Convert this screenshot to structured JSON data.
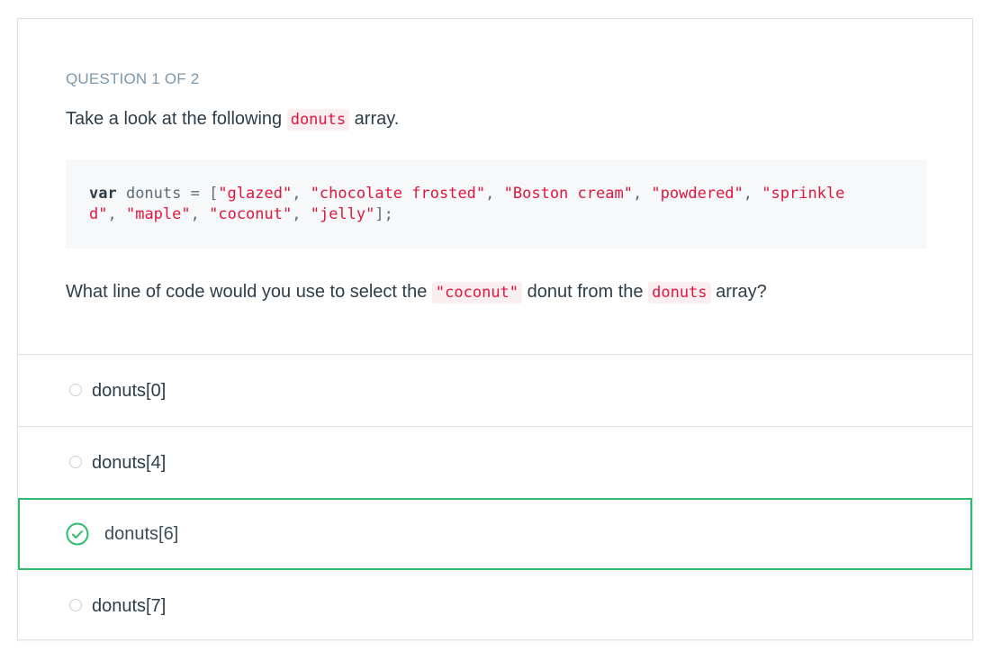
{
  "question": {
    "counter": "QUESTION 1 OF 2",
    "intro_before": "Take a look at the following ",
    "intro_code": "donuts",
    "intro_after": " array.",
    "code": {
      "keyword": "var",
      "declaration": " donuts = [",
      "items": [
        "\"glazed\"",
        "\"chocolate frosted\"",
        "\"Boston cream\"",
        "\"powdered\"",
        "\"sprinkle",
        "d\"",
        "\"maple\"",
        "\"coconut\"",
        "\"jelly\""
      ],
      "sep": ", ",
      "end": "];"
    },
    "prompt_before": "What line of code would you use to select the ",
    "prompt_code1": "\"coconut\"",
    "prompt_middle": " donut from the ",
    "prompt_code2": "donuts",
    "prompt_after": " array?"
  },
  "options": [
    {
      "label": "donuts[0]",
      "state": "unselected"
    },
    {
      "label": "donuts[4]",
      "state": "unselected"
    },
    {
      "label": "donuts[6]",
      "state": "correct"
    },
    {
      "label": "donuts[7]",
      "state": "unselected"
    }
  ],
  "colors": {
    "accent_correct": "#2fbc6b",
    "code_string": "#e2163d",
    "label_muted": "#7d97ad"
  }
}
